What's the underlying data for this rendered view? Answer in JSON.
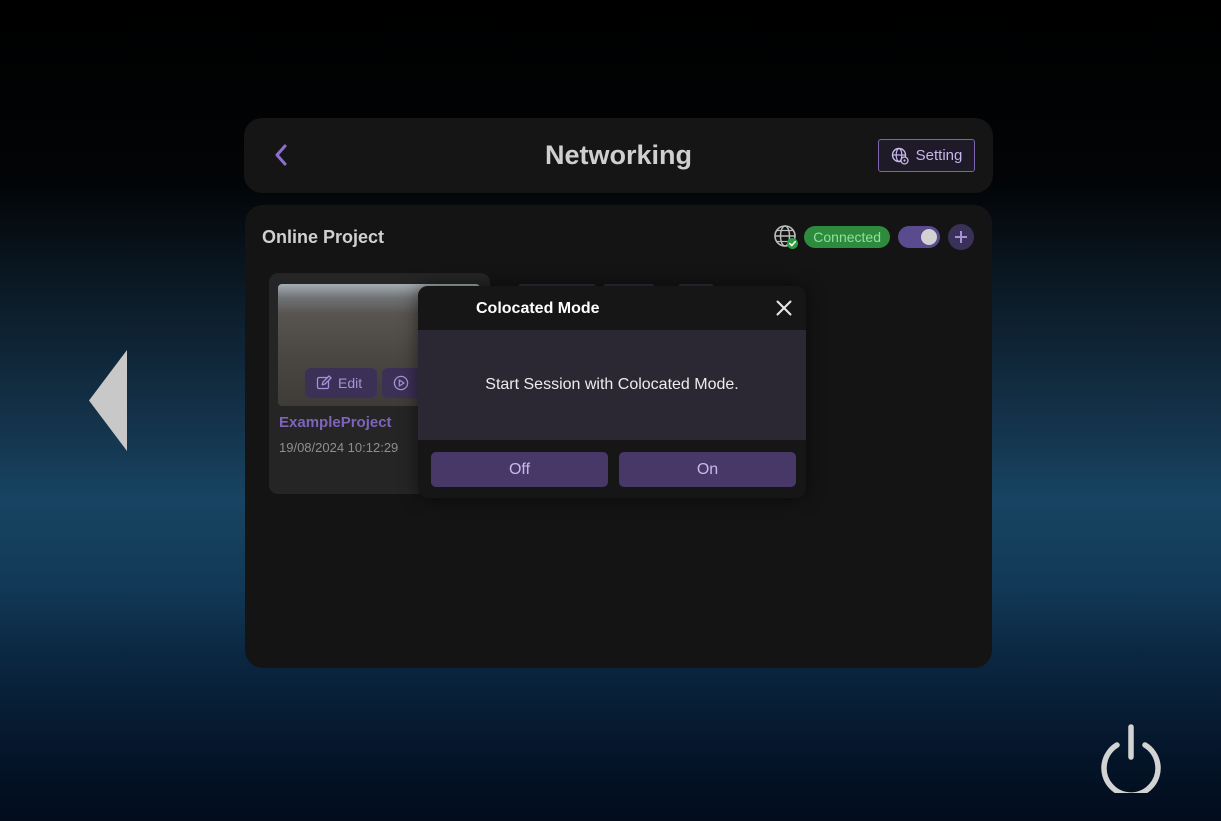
{
  "header": {
    "title": "Networking",
    "back_icon": "chevron-left-icon",
    "setting_label": "Setting",
    "setting_icon": "globe-settings-icon"
  },
  "online_project": {
    "title": "Online Project",
    "network_icon": "globe-check-icon",
    "status": "Connected",
    "toggle_on": true,
    "add_icon": "plus-icon"
  },
  "project_card": {
    "edit_label": "Edit",
    "edit_icon": "edit-icon",
    "play_icon": "play-circle-icon",
    "name": "ExampleProject",
    "date": "19/08/2024 10:12:29"
  },
  "dialog": {
    "title": "Colocated Mode",
    "message": "Start Session with Colocated Mode.",
    "off_label": "Off",
    "on_label": "On",
    "close_icon": "close-icon"
  },
  "navigation": {
    "prev_icon": "triangle-left-icon",
    "power_icon": "power-icon"
  },
  "colors": {
    "accent": "#7d64b0",
    "button_bg": "#473868",
    "connected": "#2e8b3e",
    "panel": "#151515"
  }
}
